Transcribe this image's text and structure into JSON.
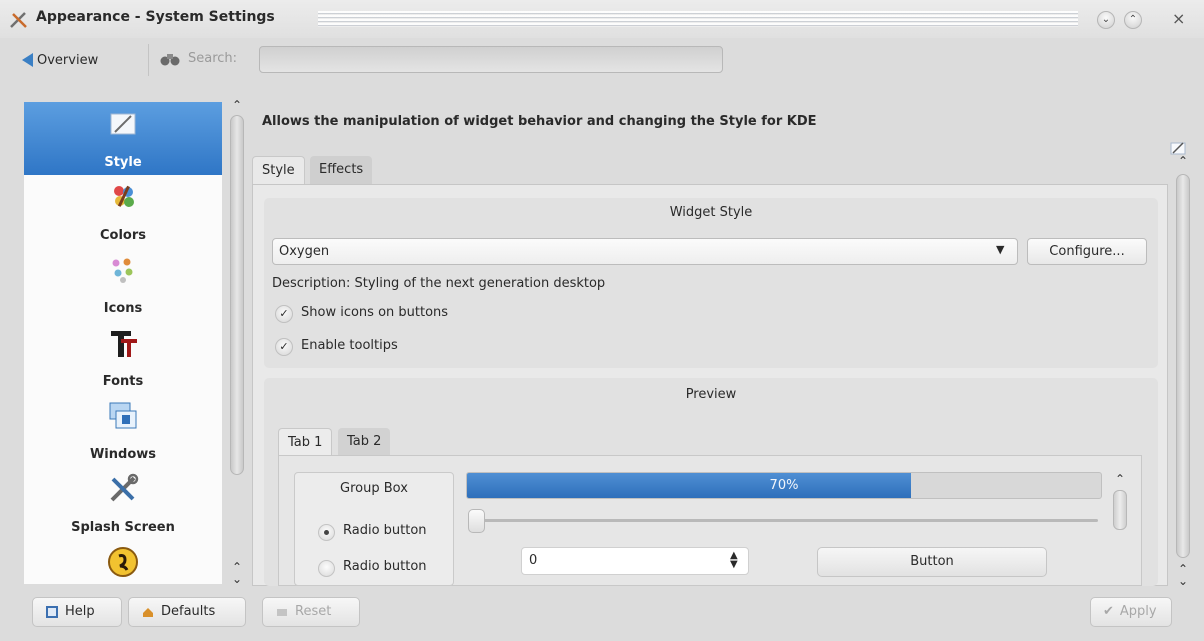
{
  "window": {
    "title": "Appearance - System Settings",
    "minimize_glyph": "⌄",
    "maximize_glyph": "⌃",
    "close_glyph": "×"
  },
  "toolbar": {
    "overview_label": "Overview",
    "search_label": "Search:",
    "search_value": "",
    "search_placeholder": ""
  },
  "sidebar": {
    "items": [
      {
        "label": "Style",
        "icon": "style-icon",
        "selected": true
      },
      {
        "label": "Colors",
        "icon": "colors-icon",
        "selected": false
      },
      {
        "label": "Icons",
        "icon": "icons-icon",
        "selected": false
      },
      {
        "label": "Fonts",
        "icon": "fonts-icon",
        "selected": false
      },
      {
        "label": "Windows",
        "icon": "windows-icon",
        "selected": false
      },
      {
        "label": "Splash Screen",
        "icon": "splash-screen-icon",
        "selected": false
      },
      {
        "label": "",
        "icon": "emoticons-icon",
        "selected": false
      }
    ]
  },
  "main": {
    "description": "Allows the manipulation of widget behavior and changing the Style for KDE",
    "tabs": [
      {
        "label": "Style",
        "active": true
      },
      {
        "label": "Effects",
        "active": false
      }
    ],
    "widget_style": {
      "title": "Widget Style",
      "selected_style": "Oxygen",
      "configure_label": "Configure...",
      "description": "Description: Styling of the next generation desktop",
      "show_icons_label": "Show icons on buttons",
      "show_icons_checked": true,
      "enable_tooltips_label": "Enable tooltips",
      "enable_tooltips_checked": true
    },
    "preview": {
      "title": "Preview",
      "tabs": [
        {
          "label": "Tab 1",
          "active": true
        },
        {
          "label": "Tab 2",
          "active": false
        }
      ],
      "group_box_title": "Group Box",
      "radio_1_label": "Radio button",
      "radio_1_checked": true,
      "radio_2_label": "Radio button",
      "radio_2_checked": false,
      "progress_text": "70%",
      "progress_value": 70,
      "slider_value": 0,
      "spinbox_value": "0",
      "button_label": "Button"
    }
  },
  "footer": {
    "help_label": "Help",
    "defaults_label": "Defaults",
    "reset_label": "Reset",
    "apply_label": "Apply"
  },
  "colors": {
    "selection_blue": "#2f76c6",
    "progress_blue": "#3a7fc4",
    "window_bg": "#dcdcdc"
  }
}
